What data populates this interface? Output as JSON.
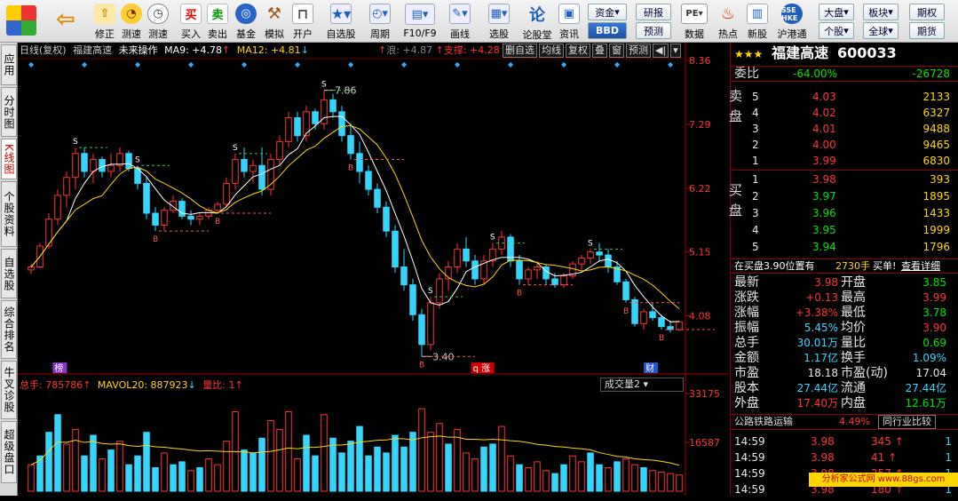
{
  "toolbar": {
    "buttons": [
      {
        "label": "修正",
        "icon": "up-arrow-icon"
      },
      {
        "label": "测速",
        "icon": "speed-icon"
      },
      {
        "label": "买入",
        "icon": "buy-icon",
        "glyph": "买"
      },
      {
        "label": "卖出",
        "icon": "sell-icon",
        "glyph": "卖"
      },
      {
        "label": "基金",
        "icon": "fund-icon"
      },
      {
        "label": "模拟",
        "icon": "hammer-icon"
      },
      {
        "label": "开户",
        "icon": "lock-icon"
      },
      {
        "label": "自选股",
        "icon": "star-icon"
      },
      {
        "label": "周期",
        "icon": "clock-icon"
      },
      {
        "label": "F10/F9",
        "icon": "f10-icon"
      },
      {
        "label": "画线",
        "icon": "pen-icon"
      },
      {
        "label": "选股",
        "icon": "filter-icon"
      },
      {
        "label": "论股堂",
        "icon": "forum-icon",
        "glyph": "论"
      },
      {
        "label": "资讯",
        "icon": "news-icon"
      },
      {
        "label": "数据",
        "icon": "pe-icon"
      },
      {
        "label": "热点",
        "icon": "fire-icon"
      },
      {
        "label": "新股",
        "icon": "new-stock-icon"
      },
      {
        "label": "沪港通",
        "icon": "sse-hk-icon"
      }
    ],
    "small": {
      "zijin": "资金",
      "bbd": "BBD",
      "yanbao": "研报",
      "yuce": "预测",
      "dapan": "大盘",
      "bankuai": "板块",
      "qihuo": "期权",
      "gegu": "个股",
      "quanqiu": "全球",
      "qihuo2": "期货"
    }
  },
  "side_tabs": [
    "应用",
    "分时图",
    "K线图",
    "个股资料",
    "自选股",
    "综合排名",
    "牛叉诊股",
    "超级盘口"
  ],
  "chart": {
    "header": {
      "period": "日线(复权)",
      "name": "福建高速",
      "mode": "未来操作",
      "ma9": "MA9: +4.78",
      "ma12": "MA12: +4.81",
      "wave": "浪: +4.87",
      "support": "支撑: +4.28"
    },
    "header_btns": [
      "删自选",
      "均线",
      "复权",
      "叠",
      "窗",
      "预测"
    ],
    "price_axis": [
      "8.36",
      "7.29",
      "6.22",
      "5.15",
      "4.08"
    ],
    "high_label": "7.86",
    "low_label": "3.40",
    "markers": {
      "m1": "榜",
      "m2": "q 涨",
      "m3": "财"
    },
    "vol_header": {
      "total": "总手: 785786",
      "mavol": "MAVOL20: 887923",
      "liangbi": "量比: 1"
    },
    "vol_select": "成交量2",
    "vol_axis": [
      "33175",
      "16587"
    ],
    "candles": [
      [
        4.85,
        4.95,
        4.78,
        4.9
      ],
      [
        4.9,
        5.3,
        4.88,
        5.25
      ],
      [
        5.25,
        5.8,
        5.2,
        5.7
      ],
      [
        5.7,
        6.2,
        5.6,
        6.1
      ],
      [
        6.1,
        6.5,
        5.9,
        6.4
      ],
      [
        6.4,
        6.9,
        6.2,
        6.8
      ],
      [
        6.8,
        6.9,
        6.4,
        6.5
      ],
      [
        6.5,
        6.8,
        6.3,
        6.7
      ],
      [
        6.7,
        6.75,
        6.4,
        6.5
      ],
      [
        6.5,
        6.8,
        6.4,
        6.6
      ],
      [
        6.6,
        6.9,
        6.5,
        6.8
      ],
      [
        6.8,
        6.85,
        6.5,
        6.55
      ],
      [
        6.55,
        6.6,
        6.2,
        6.3
      ],
      [
        6.3,
        6.4,
        5.7,
        5.8
      ],
      [
        5.8,
        5.9,
        5.5,
        5.6
      ],
      [
        5.6,
        5.9,
        5.5,
        5.85
      ],
      [
        5.85,
        6.1,
        5.8,
        6.0
      ],
      [
        6.0,
        6.05,
        5.7,
        5.75
      ],
      [
        5.75,
        5.85,
        5.6,
        5.7
      ],
      [
        5.7,
        5.8,
        5.6,
        5.75
      ],
      [
        5.75,
        5.9,
        5.7,
        5.85
      ],
      [
        5.85,
        6.0,
        5.8,
        5.95
      ],
      [
        5.95,
        6.4,
        5.9,
        6.3
      ],
      [
        6.3,
        6.8,
        6.2,
        6.7
      ],
      [
        6.7,
        6.9,
        6.4,
        6.5
      ],
      [
        6.5,
        6.7,
        6.3,
        6.6
      ],
      [
        6.6,
        6.9,
        6.1,
        6.2
      ],
      [
        6.2,
        6.8,
        6.1,
        6.7
      ],
      [
        6.7,
        7.1,
        6.6,
        7.0
      ],
      [
        7.0,
        7.5,
        6.9,
        7.4
      ],
      [
        7.4,
        7.5,
        7.0,
        7.1
      ],
      [
        7.1,
        7.6,
        7.0,
        7.5
      ],
      [
        7.5,
        7.55,
        7.2,
        7.3
      ],
      [
        7.3,
        7.86,
        7.2,
        7.7
      ],
      [
        7.7,
        7.8,
        7.4,
        7.5
      ],
      [
        7.5,
        7.6,
        7.0,
        7.1
      ],
      [
        7.1,
        7.3,
        6.7,
        6.8
      ],
      [
        6.8,
        7.0,
        6.3,
        6.5
      ],
      [
        6.5,
        6.6,
        6.1,
        6.2
      ],
      [
        6.2,
        6.3,
        5.8,
        5.9
      ],
      [
        5.9,
        6.0,
        5.4,
        5.5
      ],
      [
        5.5,
        5.6,
        4.8,
        4.9
      ],
      [
        4.9,
        5.2,
        4.5,
        4.6
      ],
      [
        4.6,
        4.7,
        4.0,
        4.1
      ],
      [
        4.1,
        4.2,
        3.4,
        3.6
      ],
      [
        3.6,
        4.4,
        3.5,
        4.3
      ],
      [
        4.3,
        4.8,
        4.2,
        4.7
      ],
      [
        4.7,
        5.0,
        4.5,
        4.9
      ],
      [
        4.9,
        5.3,
        4.8,
        5.2
      ],
      [
        5.2,
        5.4,
        4.9,
        5.0
      ],
      [
        5.0,
        5.1,
        4.6,
        4.7
      ],
      [
        4.7,
        5.1,
        4.6,
        5.0
      ],
      [
        5.0,
        5.3,
        4.9,
        5.2
      ],
      [
        5.2,
        5.5,
        5.1,
        5.4
      ],
      [
        5.4,
        5.45,
        4.9,
        5.0
      ],
      [
        5.0,
        5.1,
        4.6,
        4.7
      ],
      [
        4.7,
        4.9,
        4.6,
        4.85
      ],
      [
        4.85,
        5.0,
        4.7,
        4.9
      ],
      [
        4.9,
        4.95,
        4.6,
        4.7
      ],
      [
        4.7,
        4.8,
        4.55,
        4.6
      ],
      [
        4.6,
        4.8,
        4.55,
        4.75
      ],
      [
        4.75,
        5.0,
        4.7,
        4.95
      ],
      [
        4.95,
        5.1,
        4.85,
        5.05
      ],
      [
        5.05,
        5.2,
        4.95,
        5.15
      ],
      [
        5.15,
        5.3,
        5.0,
        5.1
      ],
      [
        5.1,
        5.2,
        4.8,
        4.9
      ],
      [
        4.9,
        5.0,
        4.6,
        4.65
      ],
      [
        4.65,
        4.7,
        4.3,
        4.35
      ],
      [
        4.35,
        4.4,
        3.9,
        3.95
      ],
      [
        3.95,
        4.2,
        3.85,
        4.15
      ],
      [
        4.15,
        4.3,
        4.0,
        4.05
      ],
      [
        4.05,
        4.1,
        3.85,
        3.9
      ],
      [
        3.9,
        4.0,
        3.8,
        3.85
      ],
      [
        3.85,
        4.0,
        3.82,
        3.98
      ]
    ],
    "volumes": [
      9000,
      12000,
      20000,
      26000,
      16000,
      21000,
      12000,
      19000,
      11000,
      14000,
      17000,
      9000,
      12000,
      20000,
      8000,
      13000,
      9000,
      10000,
      7000,
      8000,
      11000,
      9000,
      17000,
      27000,
      14000,
      13000,
      18000,
      24000,
      21000,
      27000,
      11000,
      19000,
      12000,
      26000,
      18000,
      13000,
      17000,
      22000,
      12000,
      15000,
      13000,
      19000,
      15000,
      20000,
      28000,
      20000,
      23000,
      16000,
      21000,
      13000,
      11000,
      15000,
      16000,
      22000,
      12000,
      9000,
      8000,
      10000,
      7000,
      6000,
      9000,
      12000,
      10000,
      13000,
      9000,
      8000,
      10000,
      11000,
      9000,
      8000,
      7000,
      6500,
      6000,
      5500
    ],
    "vol_colors": "rgcgrrggrgrggcgrggrgrrrrgggrrrrcgrgggggggggcrrrgrrrggrrgrrrggrrggrgrrgr"
  },
  "info": {
    "stars": "★★★",
    "title": "福建高速",
    "code": "600033",
    "weibi_label": "委比",
    "weibi": "-64.00%",
    "weicha": "-26728",
    "sell_label": "卖盘",
    "buy_label": "买盘",
    "asks": [
      {
        "n": "5",
        "p": "4.03",
        "v": "2133"
      },
      {
        "n": "4",
        "p": "4.02",
        "v": "6327"
      },
      {
        "n": "3",
        "p": "4.01",
        "v": "9488"
      },
      {
        "n": "2",
        "p": "4.00",
        "v": "9465"
      },
      {
        "n": "1",
        "p": "3.99",
        "v": "6830"
      }
    ],
    "bids": [
      {
        "n": "1",
        "p": "3.98",
        "v": "393"
      },
      {
        "n": "2",
        "p": "3.97",
        "v": "1895"
      },
      {
        "n": "3",
        "p": "3.96",
        "v": "1433"
      },
      {
        "n": "4",
        "p": "3.95",
        "v": "1999"
      },
      {
        "n": "5",
        "p": "3.94",
        "v": "1796"
      }
    ],
    "notice": "在买盘3.90位置有",
    "notice_vol": "2730手",
    "notice_buy": "买单!",
    "notice_link": "查看详细",
    "quotes": [
      {
        "l": "最新",
        "v": "3.98",
        "c": "red",
        "l2": "开盘",
        "v2": "3.85",
        "c2": "grn"
      },
      {
        "l": "涨跌",
        "v": "+0.13",
        "c": "red",
        "l2": "最高",
        "v2": "3.99",
        "c2": "red"
      },
      {
        "l": "涨幅",
        "v": "+3.38%",
        "c": "red",
        "l2": "最低",
        "v2": "3.78",
        "c2": "grn"
      },
      {
        "l": "振幅",
        "v": "5.45%",
        "c": "cy",
        "l2": "均价",
        "v2": "3.90",
        "c2": "red"
      },
      {
        "l": "总手",
        "v": "30.01万",
        "c": "cy",
        "l2": "量比",
        "v2": "0.69",
        "c2": "grn"
      },
      {
        "l": "金额",
        "v": "1.17亿",
        "c": "cy",
        "l2": "换手",
        "v2": "1.09%",
        "c2": "cy"
      },
      {
        "l": "市盈",
        "v": "18.18",
        "c": "wht",
        "l2": "市盈(动)",
        "v2": "17.04",
        "c2": "wht"
      },
      {
        "l": "股本",
        "v": "27.44亿",
        "c": "cy",
        "l2": "流通",
        "v2": "27.44亿",
        "c2": "cy"
      },
      {
        "l": "外盘",
        "v": "17.40万",
        "c": "red",
        "l2": "内盘",
        "v2": "12.61万",
        "c2": "grn"
      }
    ],
    "industry": "公路铁路运输",
    "industry_pct": "4.49%",
    "compare": "同行业比较",
    "ticks": [
      {
        "t": "14:59",
        "p": "3.98",
        "v": "345",
        "s": "1"
      },
      {
        "t": "14:59",
        "p": "3.98",
        "v": "41",
        "s": "1"
      },
      {
        "t": "14:59",
        "p": "3.98",
        "v": "257",
        "s": "1"
      },
      {
        "t": "14:59",
        "p": "3.98",
        "v": "180",
        "s": "1"
      }
    ],
    "watermark": "分析家公式网 www.88gs.com"
  }
}
